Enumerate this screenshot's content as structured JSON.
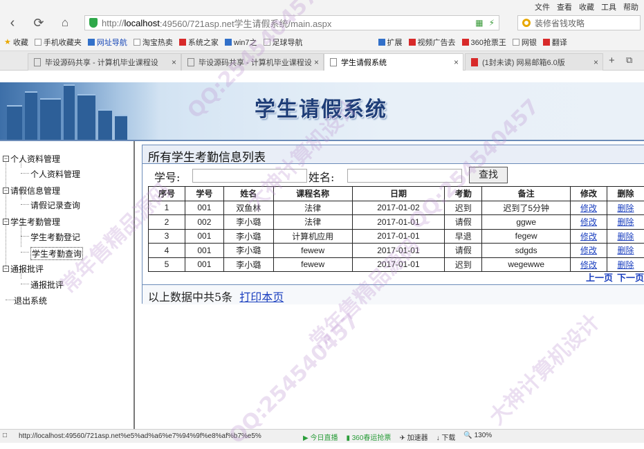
{
  "menu": [
    "文件",
    "查看",
    "收藏",
    "工具",
    "帮助"
  ],
  "address": {
    "prefix": "http://",
    "host": "localhost",
    "rest": ":49560/721asp.net学生请假系统/main.aspx"
  },
  "search": {
    "placeholder": "装修省钱攻略"
  },
  "bookmarks": [
    "收藏",
    "手机收藏夹",
    "网址导航",
    "淘宝热卖",
    "系统之家",
    "win7之",
    "足球导航",
    "扩展",
    "视频广告去",
    "360抢票王",
    "网银",
    "翻译"
  ],
  "tabs": [
    {
      "label": "毕设源码共享 - 计算机毕业课程设"
    },
    {
      "label": "毕设源码共享 - 计算机毕业课程设"
    },
    {
      "label": "学生请假系统"
    },
    {
      "label": "(1封未读) 网易邮箱6.0版"
    }
  ],
  "app": {
    "banner_title": "学生请假系统"
  },
  "sidebar": {
    "groups": [
      {
        "label": "个人资料管理",
        "items": [
          "个人资料管理"
        ]
      },
      {
        "label": "请假信息管理",
        "items": [
          "请假记录查询"
        ]
      },
      {
        "label": "学生考勤管理",
        "items": [
          "学生考勤登记",
          "学生考勤查询"
        ]
      },
      {
        "label": "通报批评",
        "items": [
          "通报批评"
        ]
      }
    ],
    "logout": "退出系统"
  },
  "panel": {
    "title": "所有学生考勤信息列表",
    "student_id_label": "学号:",
    "name_label": "姓名:",
    "search_button": "查找",
    "columns": [
      "序号",
      "学号",
      "姓名",
      "课程名称",
      "日期",
      "考勤",
      "备注",
      "修改",
      "删除"
    ],
    "rows": [
      [
        "1",
        "001",
        "双鱼林",
        "法律",
        "2017-01-02",
        "迟到",
        "迟到了5分钟",
        "修改",
        "删除"
      ],
      [
        "2",
        "002",
        "李小璐",
        "法律",
        "2017-01-01",
        "请假",
        "ggwe",
        "修改",
        "删除"
      ],
      [
        "3",
        "001",
        "李小璐",
        "计算机应用",
        "2017-01-01",
        "早退",
        "fegew",
        "修改",
        "删除"
      ],
      [
        "4",
        "001",
        "李小璐",
        "fewew",
        "2017-01-01",
        "请假",
        "sdgds",
        "修改",
        "删除"
      ],
      [
        "5",
        "001",
        "李小璐",
        "fewew",
        "2017-01-01",
        "迟到",
        "wegewwe",
        "修改",
        "删除"
      ]
    ],
    "prev_page": "上一页",
    "next_page": "下一页",
    "summary": "以上数据中共5条",
    "print_link": "打印本页"
  },
  "status": {
    "url": "http://localhost:49560/721asp.net%e5%ad%a6%e7%94%9f%e8%af%b7%e5%",
    "items": [
      "今日直播",
      "360春运抢票",
      "加速器",
      "下载",
      "130%"
    ]
  },
  "watermarks": [
    "QQ:254540457",
    "大神计算机设计",
    "常年售精品源码"
  ]
}
